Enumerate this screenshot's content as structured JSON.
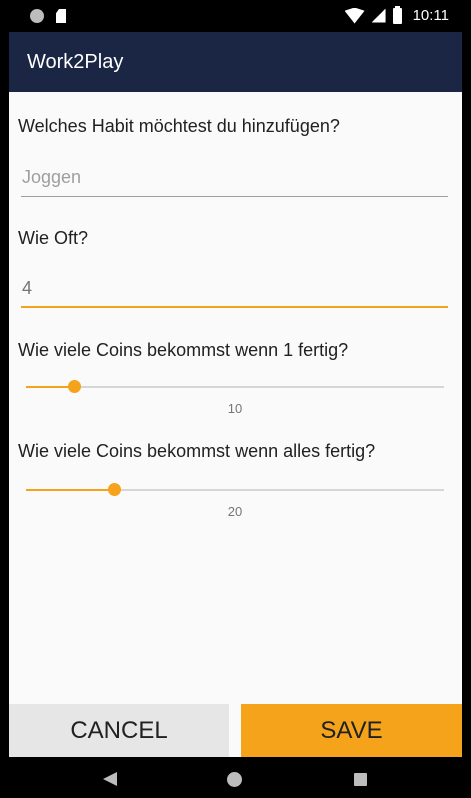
{
  "status_bar": {
    "time": "10:11",
    "icons": [
      "notification-dot-icon",
      "sd-card-icon",
      "wifi-icon",
      "signal-icon",
      "battery-icon"
    ]
  },
  "app_bar": {
    "title": "Work2Play"
  },
  "form": {
    "habit_label": "Welches Habit möchtest du hinzufügen?",
    "habit_placeholder": "Joggen",
    "habit_value": "",
    "frequency_label": "Wie Oft?",
    "frequency_value": "4",
    "coins_single_label": "Wie viele Coins bekommst wenn 1 fertig?",
    "coins_single_value": "10",
    "coins_single_fraction": 0.1,
    "coins_all_label": "Wie viele Coins bekommst wenn alles fertig?",
    "coins_all_value": "20",
    "coins_all_fraction": 0.2
  },
  "buttons": {
    "cancel": "CANCEL",
    "save": "SAVE"
  },
  "colors": {
    "app_bar": "#1a2644",
    "accent": "#f5a31a",
    "cancel_button": "#e6e6e6",
    "background": "#fafafa"
  },
  "nav_bar": {
    "icons": [
      "back-icon",
      "home-icon",
      "recent-apps-icon"
    ]
  }
}
